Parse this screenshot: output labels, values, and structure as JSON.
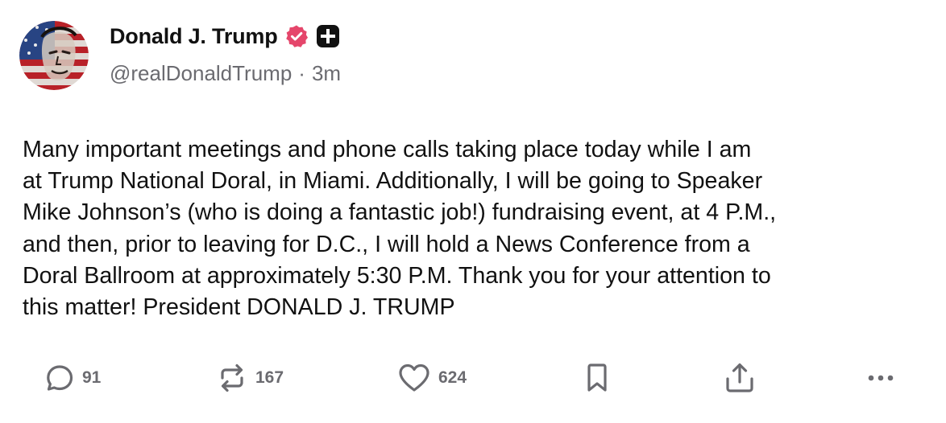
{
  "post": {
    "author": {
      "display_name": "Donald J. Trump",
      "handle": "@realDonaldTrump",
      "verified_icon": "verified-badge-icon",
      "badge_icon": "plus-badge-icon"
    },
    "separator": "·",
    "time_ago": "3m",
    "text": "Many important meetings and phone calls taking place today while I am\nat Trump National Doral, in Miami. Additionally, I will be going to Speaker\nMike Johnson’s (who is doing a fantastic job!) fundraising event, at 4 P.M.,\nand then, prior to leaving for D.C., I will hold a News Conference from a\nDoral Ballroom at approximately 5:30 P.M. Thank you for your attention to\nthis matter! President DONALD J. TRUMP",
    "actions": {
      "reply": {
        "icon": "reply-icon",
        "count": "91"
      },
      "retruth": {
        "icon": "repost-icon",
        "count": "167"
      },
      "like": {
        "icon": "heart-icon",
        "count": "624"
      },
      "bookmark": {
        "icon": "bookmark-icon"
      },
      "share": {
        "icon": "share-icon"
      },
      "more": {
        "icon": "more-icon"
      }
    }
  },
  "colors": {
    "text_primary": "#111111",
    "text_secondary": "#6b6b70",
    "verified_badge": "#e5466b",
    "plus_badge": "#111111"
  }
}
